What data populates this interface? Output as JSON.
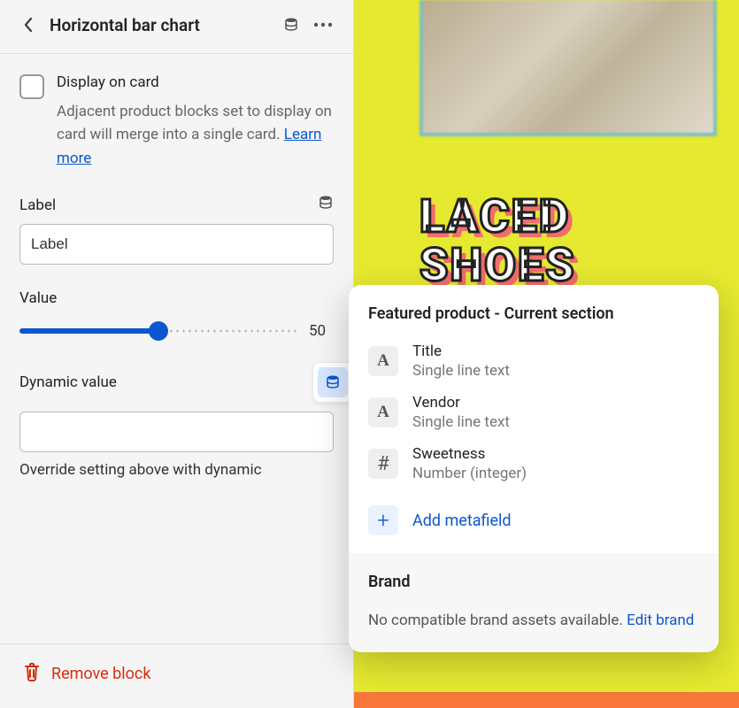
{
  "header": {
    "title": "Horizontal bar chart"
  },
  "display_on_card": {
    "label": "Display on card",
    "help": "Adjacent product blocks set to display on card will merge into a single card. ",
    "learn_more": "Learn more"
  },
  "label_field": {
    "label": "Label",
    "value": "Label"
  },
  "value_field": {
    "label": "Value",
    "value": "50"
  },
  "dynamic": {
    "label": "Dynamic value",
    "input_value": "",
    "override_hint": "Override setting above with dynamic"
  },
  "footer": {
    "remove": "Remove block"
  },
  "preview": {
    "product_title": "LACED SHOES"
  },
  "popover": {
    "section_title": "Featured product - Current section",
    "metafields": [
      {
        "icon": "A",
        "name": "Title",
        "type": "Single line text"
      },
      {
        "icon": "A",
        "name": "Vendor",
        "type": "Single line text"
      },
      {
        "icon": "#",
        "name": "Sweetness",
        "type": "Number (integer)"
      }
    ],
    "add_label": "Add metafield",
    "brand": {
      "title": "Brand",
      "message": "No compatible brand assets available. ",
      "edit": "Edit brand"
    }
  }
}
